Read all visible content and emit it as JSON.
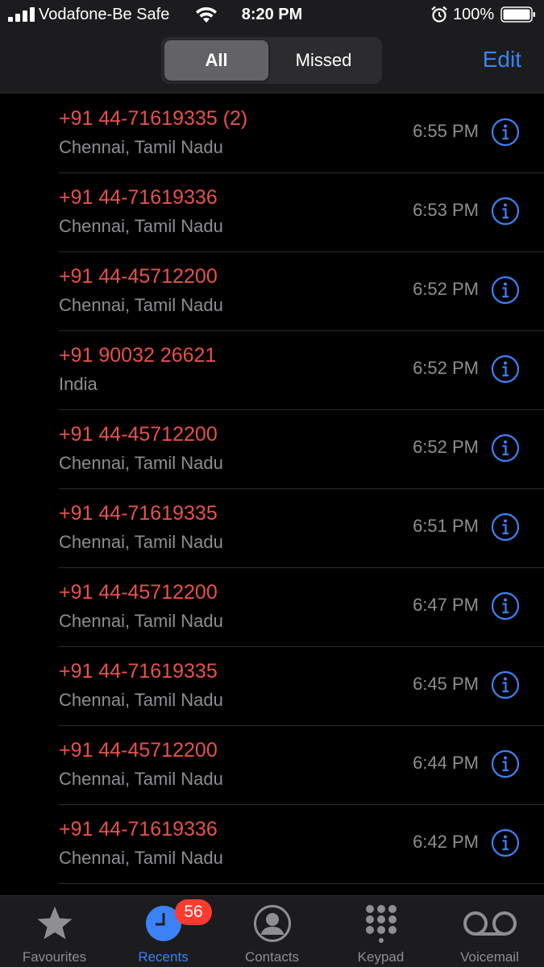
{
  "status_bar": {
    "carrier": "Vodafone-Be Safe",
    "time": "8:20 PM",
    "battery": "100%"
  },
  "header": {
    "segments": [
      "All",
      "Missed"
    ],
    "selected_segment": "All",
    "edit_label": "Edit"
  },
  "calls": [
    {
      "number": "+91 44-71619335 (2)",
      "location": "Chennai, Tamil Nadu",
      "time": "6:55 PM"
    },
    {
      "number": "+91 44-71619336",
      "location": "Chennai, Tamil Nadu",
      "time": "6:53 PM"
    },
    {
      "number": "+91 44-45712200",
      "location": "Chennai, Tamil Nadu",
      "time": "6:52 PM"
    },
    {
      "number": "+91 90032 26621",
      "location": "India",
      "time": "6:52 PM"
    },
    {
      "number": "+91 44-45712200",
      "location": "Chennai, Tamil Nadu",
      "time": "6:52 PM"
    },
    {
      "number": "+91 44-71619335",
      "location": "Chennai, Tamil Nadu",
      "time": "6:51 PM"
    },
    {
      "number": "+91 44-45712200",
      "location": "Chennai, Tamil Nadu",
      "time": "6:47 PM"
    },
    {
      "number": "+91 44-71619335",
      "location": "Chennai, Tamil Nadu",
      "time": "6:45 PM"
    },
    {
      "number": "+91 44-45712200",
      "location": "Chennai, Tamil Nadu",
      "time": "6:44 PM"
    },
    {
      "number": "+91 44-71619336",
      "location": "Chennai, Tamil Nadu",
      "time": "6:42 PM"
    }
  ],
  "tabbar": {
    "tabs": [
      {
        "label": "Favourites",
        "icon": "star-icon"
      },
      {
        "label": "Recents",
        "icon": "clock-icon",
        "badge": "56",
        "active": true
      },
      {
        "label": "Contacts",
        "icon": "person-icon"
      },
      {
        "label": "Keypad",
        "icon": "keypad-icon"
      },
      {
        "label": "Voicemail",
        "icon": "voicemail-icon"
      }
    ]
  },
  "colors": {
    "missed_red": "#e8514a",
    "accent_blue": "#3b82f6",
    "secondary_gray": "#8e8e93",
    "badge_red": "#ff3b30"
  }
}
